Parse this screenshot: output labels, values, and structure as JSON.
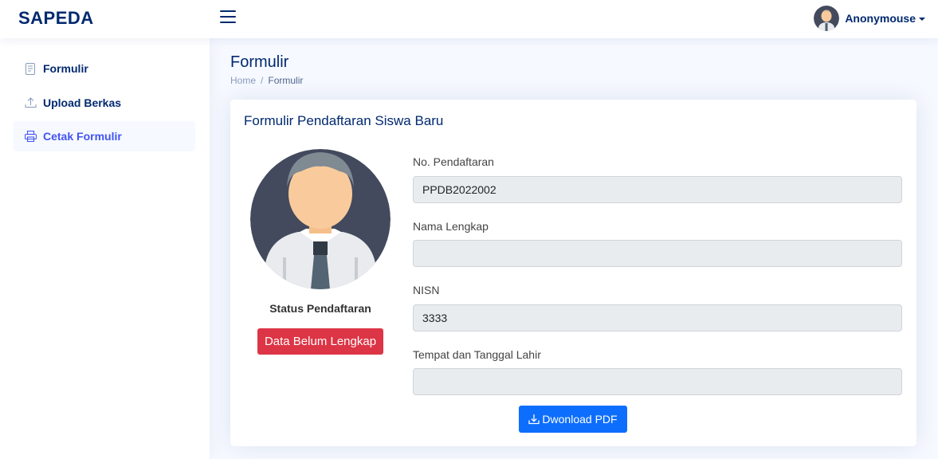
{
  "app": {
    "brand": "SAPEDA"
  },
  "header": {
    "menu_icon": "hamburger-icon",
    "user": {
      "name": "Anonymouse",
      "avatar_icon": "user-avatar-icon"
    }
  },
  "sidebar": {
    "items": [
      {
        "label": "Formulir",
        "icon": "form-icon",
        "active": false
      },
      {
        "label": "Upload Berkas",
        "icon": "upload-icon",
        "active": false
      },
      {
        "label": "Cetak Formulir",
        "icon": "printer-icon",
        "active": true
      }
    ]
  },
  "page": {
    "title": "Formulir",
    "breadcrumb": [
      "Home",
      "Formulir"
    ]
  },
  "card": {
    "title": "Formulir Pendaftaran Siswa Baru",
    "status_label": "Status Pendaftaran",
    "status_badge": "Data Belum Lengkap",
    "fields": [
      {
        "label": "No. Pendaftaran",
        "value": "PPDB2022002"
      },
      {
        "label": "Nama Lengkap",
        "value": ""
      },
      {
        "label": "NISN",
        "value": "3333"
      },
      {
        "label": "Tempat dan Tanggal Lahir",
        "value": ""
      }
    ],
    "download_label": "Dwonload PDF"
  },
  "colors": {
    "brand": "#012970",
    "accent": "#4154f1",
    "badge_danger": "#dc3545",
    "button_primary": "#0d6efd",
    "input_disabled_bg": "#e9ecef"
  }
}
